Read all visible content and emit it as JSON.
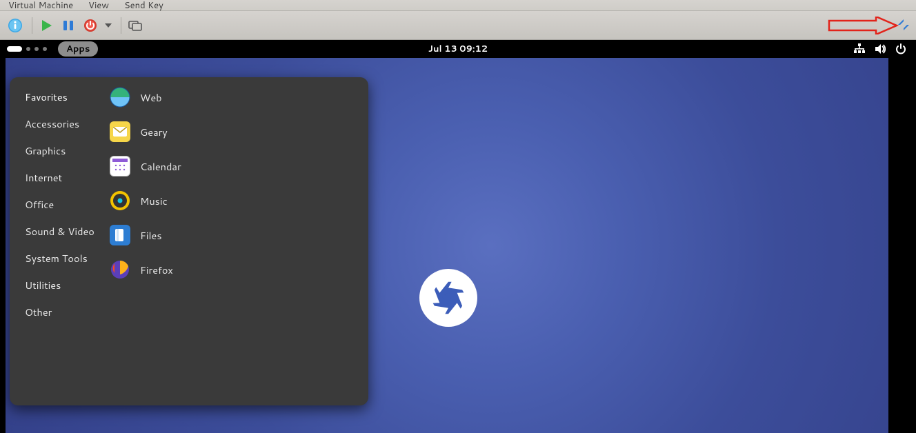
{
  "host": {
    "menu": {
      "vm": "Virtual Machine",
      "view": "View",
      "sendkey": "Send Key"
    }
  },
  "topbar": {
    "apps_label": "Apps",
    "datetime": "Jul 13  09:12"
  },
  "menu": {
    "categories": [
      "Favorites",
      "Accessories",
      "Graphics",
      "Internet",
      "Office",
      "Sound & Video",
      "System Tools",
      "Utilities",
      "Other"
    ],
    "apps": [
      {
        "label": "Web"
      },
      {
        "label": "Geary"
      },
      {
        "label": "Calendar"
      },
      {
        "label": "Music"
      },
      {
        "label": "Files"
      },
      {
        "label": "Firefox"
      }
    ]
  }
}
